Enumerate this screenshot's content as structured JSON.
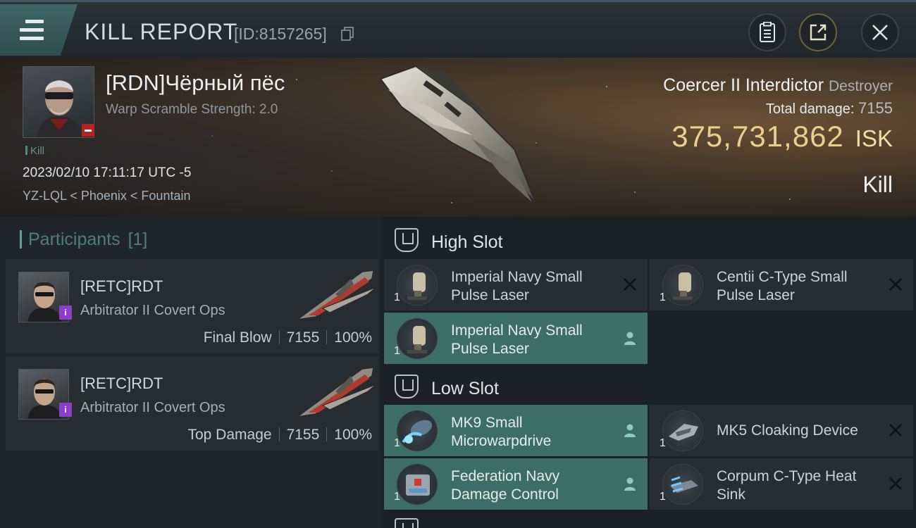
{
  "header": {
    "title": "KILL REPORT",
    "report_id": "[ID:8157265]"
  },
  "victim": {
    "name": "[RDN]Чёрный пёс",
    "warp_scramble": "Warp Scramble Strength: 2.0",
    "tag": "Kill",
    "datetime": "2023/02/10 17:11:17 UTC -5",
    "location": "YZ-LQL < Phoenix < Fountain",
    "ship_name": "Coercer II Interdictor",
    "ship_class": "Destroyer",
    "total_damage_label": "Total damage:",
    "total_damage_value": "7155",
    "isk_value": "375,731,862",
    "isk_label": "ISK",
    "result": "Kill"
  },
  "participants": {
    "label": "Participants",
    "count": "[1]",
    "items": [
      {
        "name": "[RETC]RDT",
        "ship": "Arbitrator II Covert Ops",
        "role": "Final Blow",
        "damage": "7155",
        "percent": "100%"
      },
      {
        "name": "[RETC]RDT",
        "ship": "Arbitrator II Covert Ops",
        "role": "Top Damage",
        "damage": "7155",
        "percent": "100%"
      }
    ]
  },
  "fitting": {
    "high_slot_label": "High Slot",
    "low_slot_label": "Low Slot",
    "high": [
      {
        "name": "Imperial Navy Small Pulse Laser",
        "qty": "1",
        "state": "destroyed"
      },
      {
        "name": "Centii C-Type Small Pulse Laser",
        "qty": "1",
        "state": "destroyed"
      },
      {
        "name": "Imperial Navy Small Pulse Laser",
        "qty": "1",
        "state": "dropped"
      }
    ],
    "low": [
      {
        "name": "MK9 Small Microwarpdrive",
        "qty": "1",
        "state": "dropped"
      },
      {
        "name": "MK5 Cloaking Device",
        "qty": "1",
        "state": "destroyed"
      },
      {
        "name": "Federation Navy Damage Control",
        "qty": "1",
        "state": "dropped"
      },
      {
        "name": "Corpum C-Type Heat Sink",
        "qty": "1",
        "state": "destroyed"
      }
    ]
  },
  "colors": {
    "accent_teal": "#3d6e66",
    "isk_gold": "#e8cf8e",
    "danger_red": "#b8231f",
    "badge_purple": "#8b3fc9"
  }
}
